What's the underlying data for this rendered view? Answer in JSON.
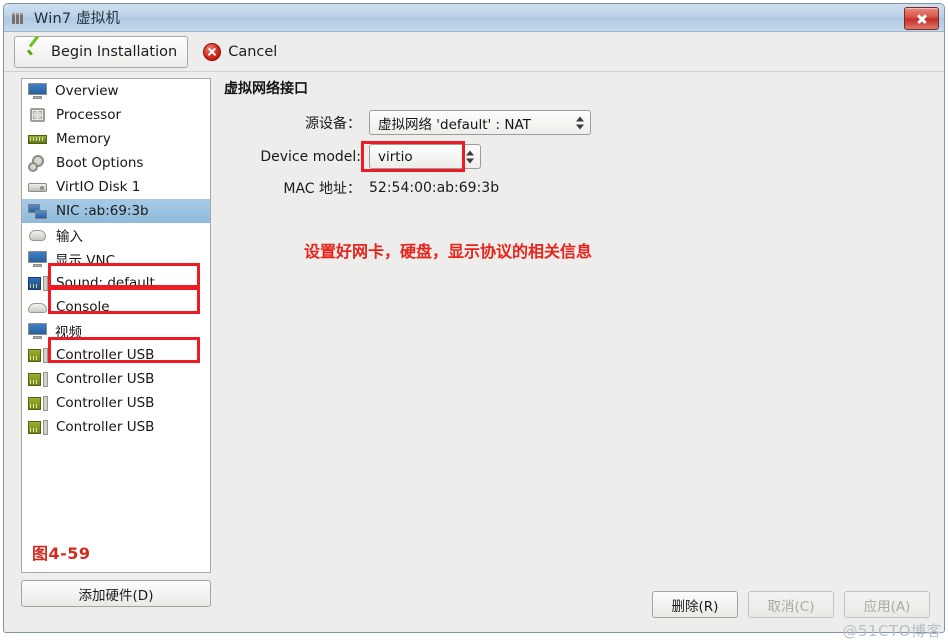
{
  "window": {
    "title": "Win7 虚拟机",
    "icon": "window-menu-icon",
    "close_label": "close-icon"
  },
  "toolbar": {
    "begin_installation": "Begin Installation",
    "cancel": "Cancel"
  },
  "sidebar": {
    "items": [
      {
        "label": "Overview",
        "icon": "monitor-icon",
        "selected": false
      },
      {
        "label": "Processor",
        "icon": "cpu-icon",
        "selected": false
      },
      {
        "label": "Memory",
        "icon": "memory-icon",
        "selected": false
      },
      {
        "label": "Boot Options",
        "icon": "gears-icon",
        "selected": false
      },
      {
        "label": "VirtIO Disk 1",
        "icon": "disk-icon",
        "selected": false
      },
      {
        "label": "NIC :ab:69:3b",
        "icon": "network-card-icon",
        "selected": true
      },
      {
        "label": "输入",
        "icon": "mouse-icon",
        "selected": false
      },
      {
        "label": "显示 VNC",
        "icon": "monitor-icon",
        "selected": false
      },
      {
        "label": "Sound: default",
        "icon": "sound-card-icon",
        "selected": false
      },
      {
        "label": "Console",
        "icon": "console-icon",
        "selected": false
      },
      {
        "label": "视频",
        "icon": "monitor-icon",
        "selected": false
      },
      {
        "label": "Controller USB",
        "icon": "usb-controller-icon",
        "selected": false
      },
      {
        "label": "Controller USB",
        "icon": "usb-controller-icon",
        "selected": false
      },
      {
        "label": "Controller USB",
        "icon": "usb-controller-icon",
        "selected": false
      },
      {
        "label": "Controller USB",
        "icon": "usb-controller-icon",
        "selected": false
      }
    ],
    "figure_caption": "图4-59",
    "add_hardware_button": "添加硬件(D)"
  },
  "main": {
    "title": "虚拟网络接口",
    "source_device": {
      "label": "源设备：",
      "value": "虚拟网络 'default' : NAT"
    },
    "device_model": {
      "label": "Device model:",
      "value": "virtio"
    },
    "mac_address": {
      "label": "MAC 地址：",
      "value": "52:54:00:ab:69:3b"
    },
    "annotation": "设置好网卡，硬盘，显示协议的相关信息"
  },
  "footer": {
    "remove": "删除(R)",
    "cancel": "取消(C)",
    "apply": "应用(A)",
    "watermark": "@51CTO博客"
  },
  "colors": {
    "annotation_red": "#e8231c",
    "highlight_blue": "#8fbadb",
    "titlebar_blue": "#bcd3e8"
  }
}
